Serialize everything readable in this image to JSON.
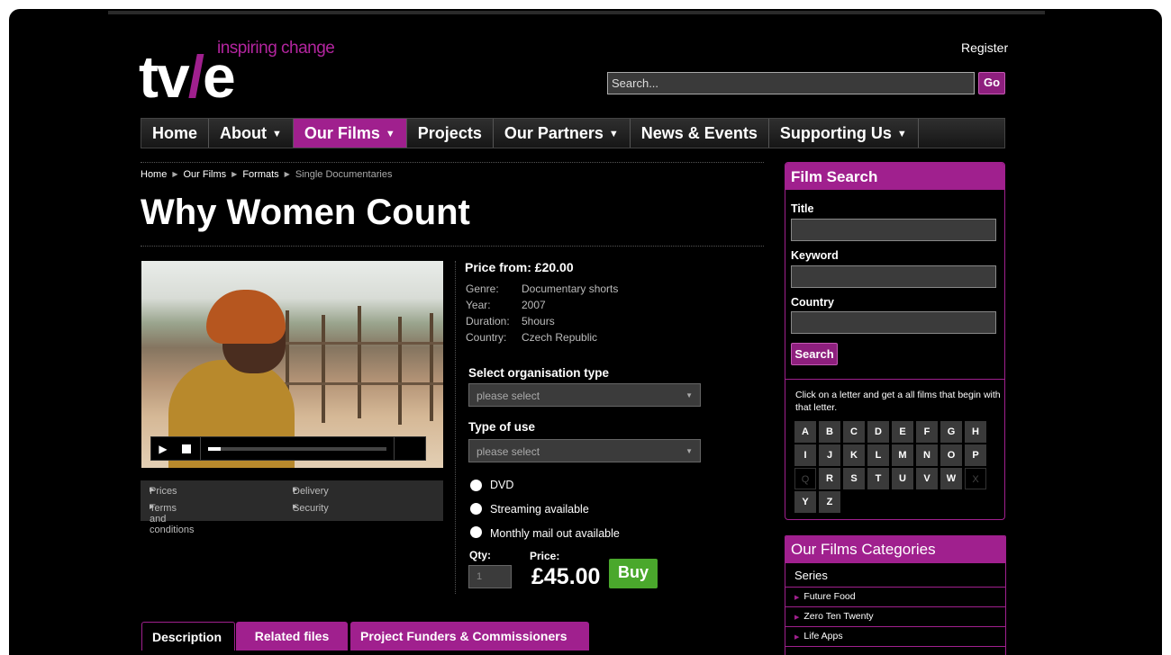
{
  "header": {
    "logo_text_left": "tv",
    "logo_slash": "/",
    "logo_text_right": "e",
    "logo_tagline": "inspiring change",
    "register_label": "Register",
    "search_placeholder": "Search...",
    "go_label": "Go"
  },
  "nav": [
    {
      "label": "Home",
      "has_menu": false
    },
    {
      "label": "About",
      "has_menu": true
    },
    {
      "label": "Our Films",
      "has_menu": true,
      "active": true
    },
    {
      "label": "Projects",
      "has_menu": false
    },
    {
      "label": "Our Partners",
      "has_menu": true
    },
    {
      "label": "News & Events",
      "has_menu": false
    },
    {
      "label": "Supporting Us",
      "has_menu": true
    }
  ],
  "breadcrumb": [
    "Home",
    "Our Films",
    "Formats",
    "Single Documentaries"
  ],
  "page_title": "Why Women Count",
  "player": {
    "progress_fraction": 0.07
  },
  "info_links": {
    "prices": "Prices",
    "delivery": "Delivery",
    "terms": "Terms and conditions",
    "security": "Security"
  },
  "product": {
    "price_from": "Price from: £20.00",
    "meta": [
      {
        "key": "Genre:",
        "value": "Documentary shorts"
      },
      {
        "key": "Year:",
        "value": "2007"
      },
      {
        "key": "Duration:",
        "value": "5hours"
      },
      {
        "key": "Country:",
        "value": "Czech Republic"
      }
    ],
    "org_type_label": "Select organisation type",
    "org_type_value": "please select",
    "use_type_label": "Type of use",
    "use_type_value": "please select",
    "options": [
      "DVD",
      "Streaming available",
      "Monthly mail out available"
    ],
    "qty_label": "Qty:",
    "qty_value": "1",
    "price_label": "Price:",
    "price_value": "£45.00",
    "buy_label": "Buy"
  },
  "tabs": [
    "Description",
    "Related files",
    "Project Funders & Commissioners"
  ],
  "film_search": {
    "title": "Film Search",
    "title_label": "Title",
    "keyword_label": "Keyword",
    "country_label": "Country",
    "search_label": "Search",
    "hint": "Click on a letter and get a all films that begin with that letter.",
    "letters": [
      "A",
      "B",
      "C",
      "D",
      "E",
      "F",
      "G",
      "H",
      "I",
      "J",
      "K",
      "L",
      "M",
      "N",
      "O",
      "P",
      "Q",
      "R",
      "S",
      "T",
      "U",
      "V",
      "W",
      "X",
      "Y",
      "Z"
    ],
    "disabled_letters": [
      "Q",
      "X"
    ]
  },
  "categories": {
    "title": "Our Films Categories",
    "group": "Series",
    "items": [
      "Future Food",
      "Zero Ten Twenty",
      "Life Apps"
    ]
  },
  "colors": {
    "accent": "#a0208e",
    "buy": "#4aa82c",
    "background": "#000000"
  }
}
